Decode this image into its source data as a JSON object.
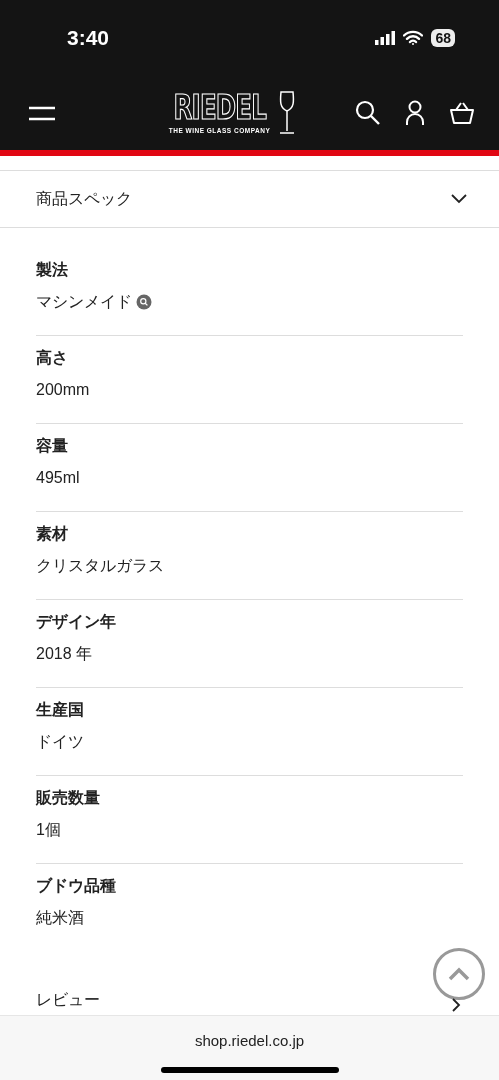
{
  "status_bar": {
    "time": "3:40",
    "battery": "68"
  },
  "header": {
    "logo": "RIEDEL",
    "tagline": "THE WINE GLASS COMPANY"
  },
  "accordion": {
    "title": "商品スペック",
    "expanded": true
  },
  "specs": [
    {
      "label": "製法",
      "value": "マシンメイド",
      "has_icon": true
    },
    {
      "label": "高さ",
      "value": "200mm",
      "has_icon": false
    },
    {
      "label": "容量",
      "value": "495ml",
      "has_icon": false
    },
    {
      "label": "素材",
      "value": "クリスタルガラス",
      "has_icon": false
    },
    {
      "label": "デザイン年",
      "value": "2018 年",
      "has_icon": false
    },
    {
      "label": "生産国",
      "value": "ドイツ",
      "has_icon": false
    },
    {
      "label": "販売数量",
      "value": "1個",
      "has_icon": false
    },
    {
      "label": "ブドウ品種",
      "value": "純米酒",
      "has_icon": false
    }
  ],
  "next_section": {
    "title": "レビュー"
  },
  "browser_bar": {
    "url": "shop.riedel.co.jp"
  }
}
